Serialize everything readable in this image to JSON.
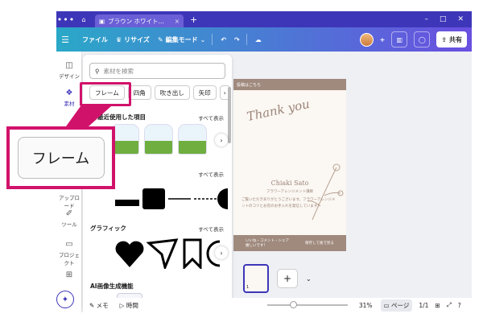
{
  "titlebar": {
    "tab_title": "ブラウン ホワイト…"
  },
  "toolbar": {
    "file": "ファイル",
    "resize": "リサイズ",
    "edit_mode": "編集モード",
    "share": "共有"
  },
  "rail": {
    "items": [
      "デザイン",
      "素材",
      "アップロード",
      "ツール",
      "プロジェクト"
    ]
  },
  "panel": {
    "search_placeholder": "素材を検索",
    "chips": [
      "フレーム",
      "四角",
      "吹き出し",
      "矢印"
    ],
    "recent": "最近使用した項目",
    "see_all": "すべて表示",
    "graphics": "グラフィック",
    "ai": "AI画像生成機能"
  },
  "canvas": {
    "banner": "投稿はこちら",
    "thank": "Thank you",
    "name": "Chiaki Sato",
    "sub": "フラワーアレンジメント講師",
    "msg": "ご覧いただきありがとうございます。フラワーアレンジメントのコツとお花のお手入れを発信しています！",
    "foot_left": "いいね・コメント・シェア嬉しいです！",
    "foot_right": "保存して後で見る"
  },
  "pages": {
    "num": "1"
  },
  "status": {
    "memo": "メモ",
    "time": "時間",
    "zoom": "31%",
    "page": "ページ",
    "page_count": "1/1"
  },
  "callout": {
    "label": "フレーム"
  }
}
